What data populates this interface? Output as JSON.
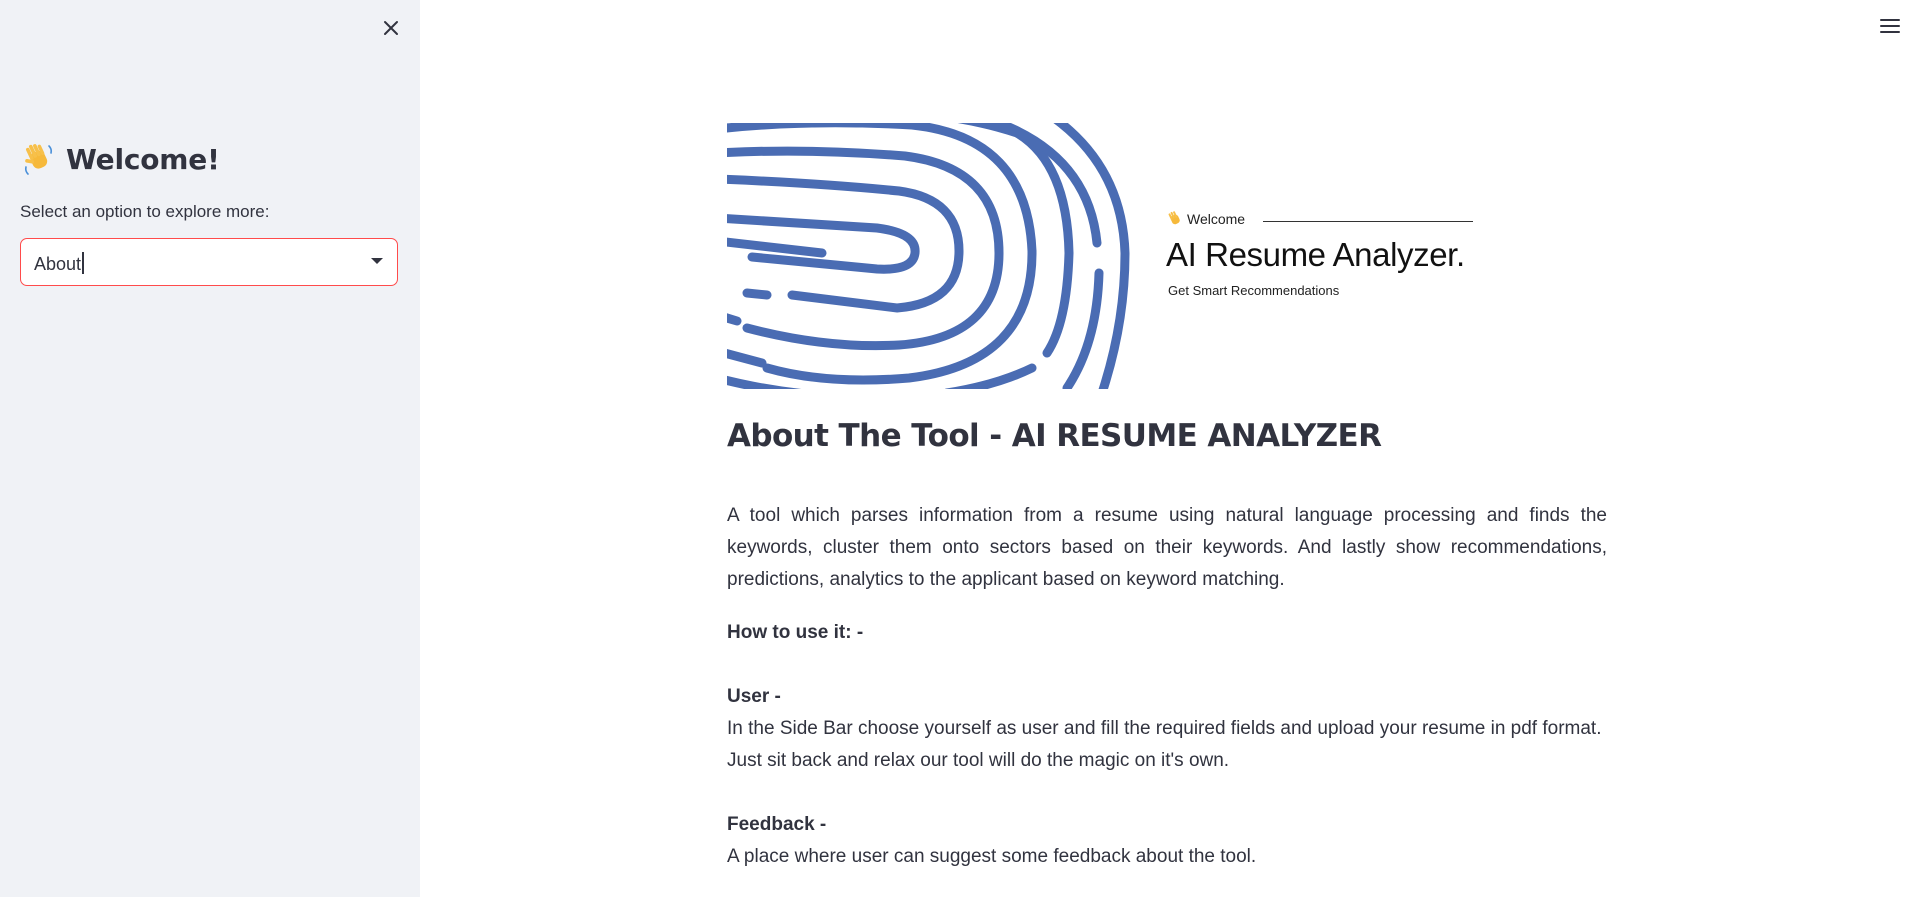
{
  "sidebar": {
    "welcome_title": "Welcome!",
    "select_label": "Select an option to explore more:",
    "select_value": "About",
    "close_icon": "close-icon",
    "wave_icon": "waving-hand-icon",
    "select_arrow_icon": "dropdown-arrow-icon"
  },
  "header": {
    "menu_icon": "hamburger-menu-icon"
  },
  "banner": {
    "welcome": "Welcome",
    "title": "AI Resume Analyzer.",
    "subtitle": "Get Smart Recommendations",
    "fingerprint_color": "#4a6cb3"
  },
  "main": {
    "title": "About The Tool - AI RESUME ANALYZER",
    "intro": "A tool which parses information from a resume using natural language processing and finds the keywords, cluster them onto sectors based on their keywords. And lastly show recommendations, predictions, analytics to the applicant based on keyword matching.",
    "how_to": "How to use it: -",
    "user_heading": "User -",
    "user_line1": "In the Side Bar choose yourself as user and fill the required fields and upload your resume in pdf format.",
    "user_line2": "Just sit back and relax our tool will do the magic on it's own.",
    "feedback_heading": "Feedback -",
    "feedback_line1": "A place where user can suggest some feedback about the tool."
  },
  "colors": {
    "sidebar_bg": "#f0f2f6",
    "text": "#31333f",
    "accent": "#ff4b4b"
  }
}
